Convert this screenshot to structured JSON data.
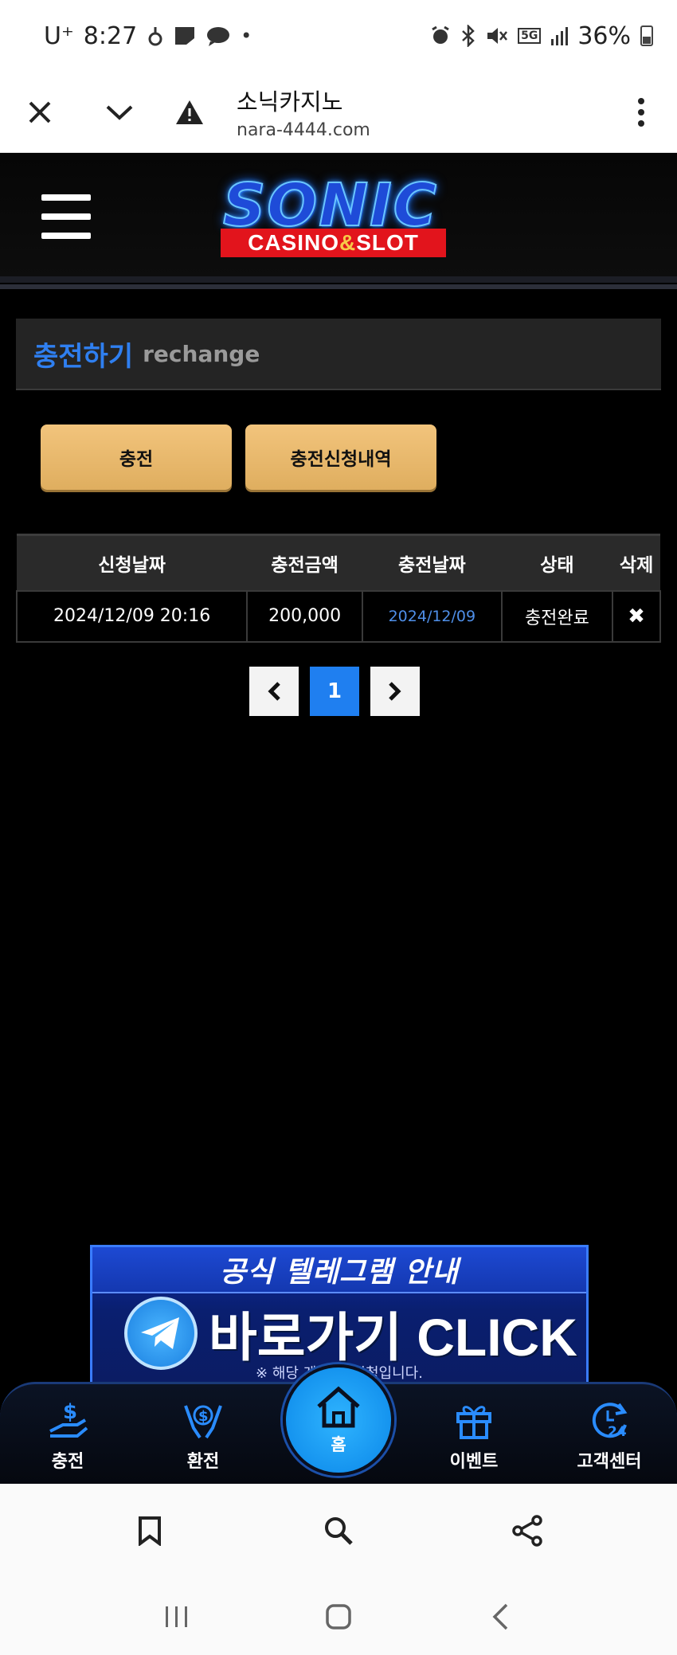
{
  "status_bar": {
    "carrier": "U⁺",
    "time": "8:27",
    "battery": "36%",
    "network": "5G"
  },
  "browser": {
    "title": "소닉카지노",
    "url": "nara-4444.com"
  },
  "logo": {
    "main": "SONIC",
    "sub_left": "CASINO",
    "sub_amp": "&",
    "sub_right": "SLOT"
  },
  "section": {
    "title": "충전하기",
    "subtitle": "rechange"
  },
  "actions": {
    "charge_label": "충전",
    "history_label": "충전신청내역"
  },
  "table": {
    "headers": [
      "신청날짜",
      "충전금액",
      "충전날짜",
      "상태",
      "삭제"
    ],
    "rows": [
      {
        "request_date": "2024/12/09 20:16",
        "amount": "200,000",
        "charge_date": "2024/12/09",
        "status": "충전완료",
        "delete": "✖"
      }
    ]
  },
  "pagination": {
    "prev": "‹",
    "current": "1",
    "next": "›"
  },
  "telegram_banner": {
    "heading": "공식 텔레그램 안내",
    "cta": "바로가기 CLICK",
    "note": "※ 해당 계정 ... 시청입니다."
  },
  "bottom_nav": {
    "items": [
      {
        "label": "충전",
        "icon": "deposit-icon"
      },
      {
        "label": "환전",
        "icon": "withdraw-icon"
      },
      {
        "label": "홈",
        "icon": "home-icon"
      },
      {
        "label": "이벤트",
        "icon": "gift-icon"
      },
      {
        "label": "고객센터",
        "icon": "support-24-icon"
      }
    ]
  },
  "colors": {
    "accent_blue": "#2f7ff0",
    "gold_button": "#efc075",
    "logo_red": "#e2141c",
    "background": "#000000"
  }
}
